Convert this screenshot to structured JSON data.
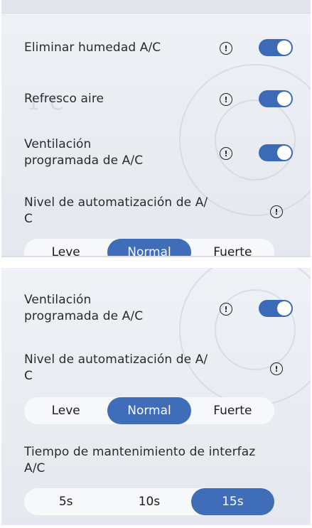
{
  "top": {
    "items": [
      {
        "label": "Eliminar humedad A/C",
        "info": "!",
        "toggle_on": true
      },
      {
        "label": "Refresco aire",
        "info": "!",
        "toggle_on": true
      },
      {
        "label_line1": "Ventilación",
        "label_line2": "programada de A/C",
        "info": "!",
        "toggle_on": true
      }
    ],
    "automation": {
      "label_line1": "Nivel de automatización de A/",
      "label_line2": "C",
      "info": "!",
      "options": [
        "Leve",
        "Normal",
        "Fuerte"
      ],
      "selected": "Normal"
    }
  },
  "bottom": {
    "ventilation": {
      "label_line1": "Ventilación",
      "label_line2": "programada de A/C",
      "info": "!",
      "toggle_on": true
    },
    "automation": {
      "label_line1": "Nivel de automatización de A/",
      "label_line2": "C",
      "info": "!",
      "options": [
        "Leve",
        "Normal",
        "Fuerte"
      ],
      "selected": "Normal"
    },
    "hold_time": {
      "label_line1": "Tiempo de mantenimiento de interfaz",
      "label_line2": "A/C",
      "options": [
        "5s",
        "10s",
        "15s"
      ],
      "selected": "15s"
    }
  },
  "colors": {
    "accent": "#3f6db8",
    "panel_bg": "#eef1f5",
    "segment_bg": "#f7f8fa"
  }
}
